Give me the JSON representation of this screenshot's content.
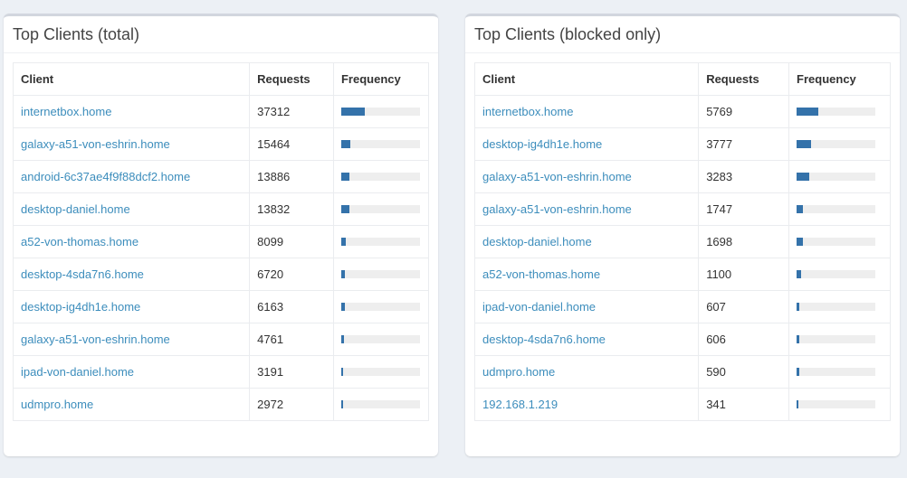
{
  "left_panel": {
    "title": "Top Clients (total)",
    "headers": {
      "client": "Client",
      "requests": "Requests",
      "frequency": "Frequency"
    },
    "rows": [
      {
        "client": "internetbox.home",
        "requests": "37312",
        "freq": 0.3
      },
      {
        "client": "galaxy-a51-von-eshrin.home",
        "requests": "15464",
        "freq": 0.12
      },
      {
        "client": "android-6c37ae4f9f88dcf2.home",
        "requests": "13886",
        "freq": 0.105
      },
      {
        "client": "desktop-daniel.home",
        "requests": "13832",
        "freq": 0.105
      },
      {
        "client": "a52-von-thomas.home",
        "requests": "8099",
        "freq": 0.06
      },
      {
        "client": "desktop-4sda7n6.home",
        "requests": "6720",
        "freq": 0.05
      },
      {
        "client": "desktop-ig4dh1e.home",
        "requests": "6163",
        "freq": 0.045
      },
      {
        "client": "galaxy-a51-von-eshrin.home",
        "requests": "4761",
        "freq": 0.035
      },
      {
        "client": "ipad-von-daniel.home",
        "requests": "3191",
        "freq": 0.025
      },
      {
        "client": "udmpro.home",
        "requests": "2972",
        "freq": 0.022
      }
    ]
  },
  "right_panel": {
    "title": "Top Clients (blocked only)",
    "headers": {
      "client": "Client",
      "requests": "Requests",
      "frequency": "Frequency"
    },
    "rows": [
      {
        "client": "internetbox.home",
        "requests": "5769",
        "freq": 0.28
      },
      {
        "client": "desktop-ig4dh1e.home",
        "requests": "3777",
        "freq": 0.18
      },
      {
        "client": "galaxy-a51-von-eshrin.home",
        "requests": "3283",
        "freq": 0.16
      },
      {
        "client": "galaxy-a51-von-eshrin.home",
        "requests": "1747",
        "freq": 0.085
      },
      {
        "client": "desktop-daniel.home",
        "requests": "1698",
        "freq": 0.08
      },
      {
        "client": "a52-von-thomas.home",
        "requests": "1100",
        "freq": 0.055
      },
      {
        "client": "ipad-von-daniel.home",
        "requests": "607",
        "freq": 0.03
      },
      {
        "client": "desktop-4sda7n6.home",
        "requests": "606",
        "freq": 0.03
      },
      {
        "client": "udmpro.home",
        "requests": "590",
        "freq": 0.03
      },
      {
        "client": "192.168.1.219",
        "requests": "341",
        "freq": 0.017
      }
    ]
  },
  "colors": {
    "bar_fill": "#3472aa",
    "bar_track": "#eeeeee",
    "link": "#3c8dbc",
    "background": "#ecf0f5"
  }
}
